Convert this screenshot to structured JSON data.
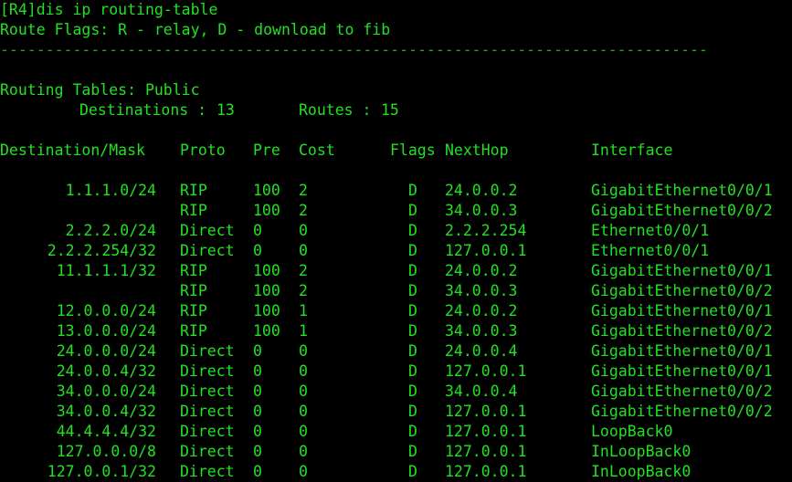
{
  "terminal": {
    "prompt_line": "[R4]dis ip routing-table",
    "route_flags_line": "Route Flags: R - relay, D - download to fib",
    "separator": "------------------------------------------------------------------------------",
    "table_scope": "Routing Tables: Public",
    "destinations_label": "Destinations :",
    "destinations_count": "13",
    "routes_label": "Routes :",
    "routes_count": "15",
    "colors": {
      "background": "#000000",
      "text": "#22e022",
      "separator": "#1fa81f"
    }
  },
  "headers": {
    "destination_mask": "Destination/Mask",
    "proto": "Proto",
    "pre": "Pre",
    "cost": "Cost",
    "flags": "Flags",
    "nexthop": "NextHop",
    "interface": "Interface"
  },
  "routes": [
    {
      "dest": "1.1.1.0/24",
      "proto": "RIP",
      "pre": "100",
      "cost": "2",
      "flags": "D",
      "nexthop": "24.0.0.2",
      "interface": "GigabitEthernet0/0/1"
    },
    {
      "dest": "",
      "proto": "RIP",
      "pre": "100",
      "cost": "2",
      "flags": "D",
      "nexthop": "34.0.0.3",
      "interface": "GigabitEthernet0/0/2"
    },
    {
      "dest": "2.2.2.0/24",
      "proto": "Direct",
      "pre": "0",
      "cost": "0",
      "flags": "D",
      "nexthop": "2.2.2.254",
      "interface": "Ethernet0/0/1"
    },
    {
      "dest": "2.2.2.254/32",
      "proto": "Direct",
      "pre": "0",
      "cost": "0",
      "flags": "D",
      "nexthop": "127.0.0.1",
      "interface": "Ethernet0/0/1"
    },
    {
      "dest": "11.1.1.1/32",
      "proto": "RIP",
      "pre": "100",
      "cost": "2",
      "flags": "D",
      "nexthop": "24.0.0.2",
      "interface": "GigabitEthernet0/0/1"
    },
    {
      "dest": "",
      "proto": "RIP",
      "pre": "100",
      "cost": "2",
      "flags": "D",
      "nexthop": "34.0.0.3",
      "interface": "GigabitEthernet0/0/2"
    },
    {
      "dest": "12.0.0.0/24",
      "proto": "RIP",
      "pre": "100",
      "cost": "1",
      "flags": "D",
      "nexthop": "24.0.0.2",
      "interface": "GigabitEthernet0/0/1"
    },
    {
      "dest": "13.0.0.0/24",
      "proto": "RIP",
      "pre": "100",
      "cost": "1",
      "flags": "D",
      "nexthop": "34.0.0.3",
      "interface": "GigabitEthernet0/0/2"
    },
    {
      "dest": "24.0.0.0/24",
      "proto": "Direct",
      "pre": "0",
      "cost": "0",
      "flags": "D",
      "nexthop": "24.0.0.4",
      "interface": "GigabitEthernet0/0/1"
    },
    {
      "dest": "24.0.0.4/32",
      "proto": "Direct",
      "pre": "0",
      "cost": "0",
      "flags": "D",
      "nexthop": "127.0.0.1",
      "interface": "GigabitEthernet0/0/1"
    },
    {
      "dest": "34.0.0.0/24",
      "proto": "Direct",
      "pre": "0",
      "cost": "0",
      "flags": "D",
      "nexthop": "34.0.0.4",
      "interface": "GigabitEthernet0/0/2"
    },
    {
      "dest": "34.0.0.4/32",
      "proto": "Direct",
      "pre": "0",
      "cost": "0",
      "flags": "D",
      "nexthop": "127.0.0.1",
      "interface": "GigabitEthernet0/0/2"
    },
    {
      "dest": "44.4.4.4/32",
      "proto": "Direct",
      "pre": "0",
      "cost": "0",
      "flags": "D",
      "nexthop": "127.0.0.1",
      "interface": "LoopBack0"
    },
    {
      "dest": "127.0.0.0/8",
      "proto": "Direct",
      "pre": "0",
      "cost": "0",
      "flags": "D",
      "nexthop": "127.0.0.1",
      "interface": "InLoopBack0"
    },
    {
      "dest": "127.0.0.1/32",
      "proto": "Direct",
      "pre": "0",
      "cost": "0",
      "flags": "D",
      "nexthop": "127.0.0.1",
      "interface": "InLoopBack0"
    }
  ]
}
